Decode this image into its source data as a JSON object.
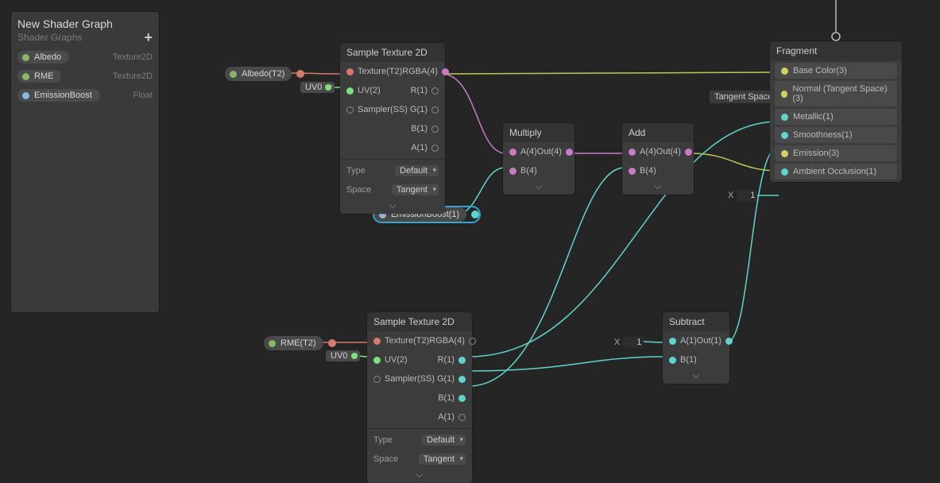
{
  "blackboard": {
    "title": "New Shader Graph",
    "subtitle": "Shader Graphs",
    "properties": [
      {
        "name": "Albedo",
        "type": "Texture2D",
        "color": "c-albedo"
      },
      {
        "name": "RME",
        "type": "Texture2D",
        "color": "c-rme"
      },
      {
        "name": "EmissionBoost",
        "type": "Float",
        "color": "c-float"
      }
    ]
  },
  "chips": {
    "albedo": {
      "label": "Albedo(T2)"
    },
    "rme": {
      "label": "RME(T2)"
    },
    "emission": {
      "label": "EmissionBoost(1)"
    }
  },
  "uv_pill": "UV0",
  "sample1": {
    "title": "Sample Texture 2D",
    "inputs": [
      "Texture(T2)",
      "UV(2)",
      "Sampler(SS)"
    ],
    "outputs": [
      "RGBA(4)",
      "R(1)",
      "G(1)",
      "B(1)",
      "A(1)"
    ],
    "type_label": "Type",
    "type_value": "Default",
    "space_label": "Space",
    "space_value": "Tangent"
  },
  "sample2": {
    "title": "Sample Texture 2D",
    "inputs": [
      "Texture(T2)",
      "UV(2)",
      "Sampler(SS)"
    ],
    "outputs": [
      "RGBA(4)",
      "R(1)",
      "G(1)",
      "B(1)",
      "A(1)"
    ],
    "type_label": "Type",
    "type_value": "Default",
    "space_label": "Space",
    "space_value": "Tangent"
  },
  "multiply": {
    "title": "Multiply",
    "inputs": [
      "A(4)",
      "B(4)"
    ],
    "output": "Out(4)"
  },
  "add": {
    "title": "Add",
    "inputs": [
      "A(4)",
      "B(4)"
    ],
    "output": "Out(4)"
  },
  "subtract": {
    "title": "Subtract",
    "inputs": [
      "A(1)",
      "B(1)"
    ],
    "output": "Out(1)"
  },
  "subtract_x": {
    "label": "X",
    "value": "1"
  },
  "ao_x": {
    "label": "X",
    "value": "1"
  },
  "tangent_space_label": "Tangent Space",
  "fragment": {
    "title": "Fragment",
    "ports": [
      {
        "label": "Base Color(3)",
        "color": "c-yel"
      },
      {
        "label": "Normal (Tangent Space)(3)",
        "color": "c-yel"
      },
      {
        "label": "Metallic(1)",
        "color": "c-teal"
      },
      {
        "label": "Smoothness(1)",
        "color": "c-teal"
      },
      {
        "label": "Emission(3)",
        "color": "c-yel"
      },
      {
        "label": "Ambient Occlusion(1)",
        "color": "c-teal"
      }
    ]
  }
}
